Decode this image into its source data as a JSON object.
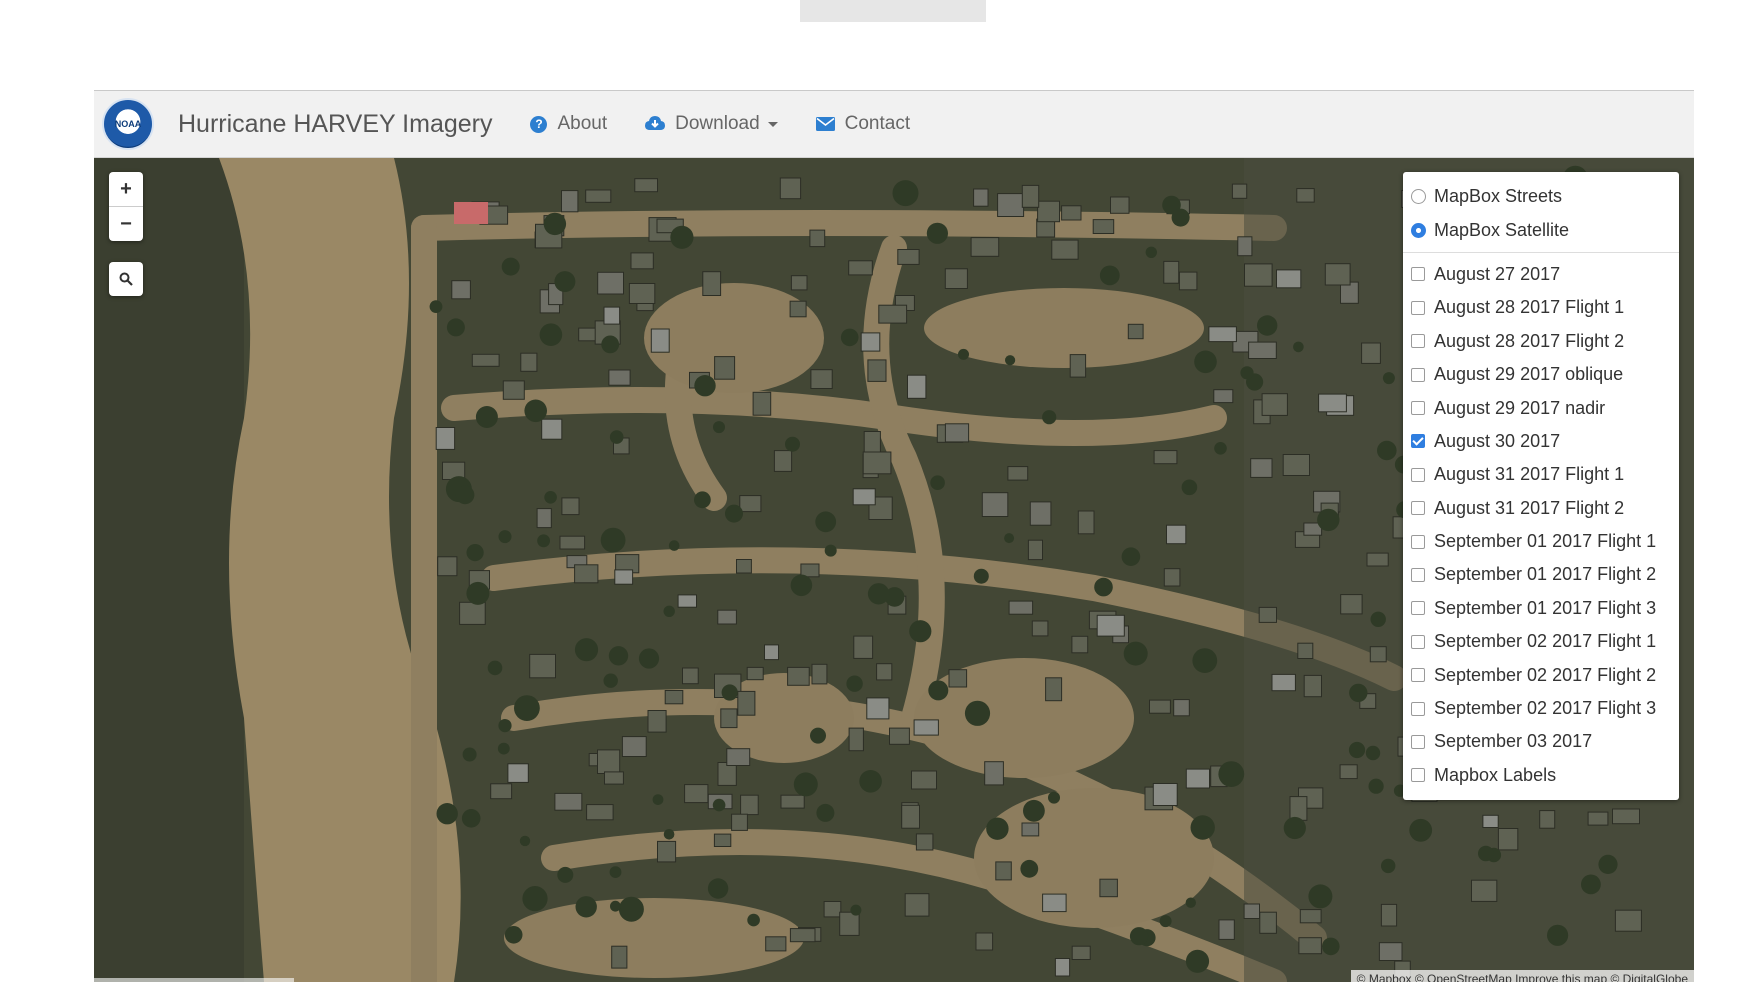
{
  "navbar": {
    "logo_text": "NOAA",
    "brand": "Hurricane HARVEY Imagery",
    "items": [
      {
        "label": "About",
        "icon": "question-circle-icon"
      },
      {
        "label": "Download",
        "icon": "cloud-download-icon",
        "dropdown": true
      },
      {
        "label": "Contact",
        "icon": "envelope-icon"
      }
    ]
  },
  "map": {
    "zoom_in": "+",
    "zoom_out": "−",
    "search_icon": "search-icon",
    "attribution": "© Mapbox © OpenStreetMap Improve this map © DigitalGlobe",
    "colors": {
      "flood_water": "#9c8a67",
      "land_dark": "#454a37",
      "radio_selected": "#2f7ee0"
    }
  },
  "layers": {
    "base": [
      {
        "label": "MapBox Streets",
        "selected": false
      },
      {
        "label": "MapBox Satellite",
        "selected": true
      }
    ],
    "overlays": [
      {
        "label": "August 27 2017",
        "checked": false
      },
      {
        "label": "August 28 2017 Flight 1",
        "checked": false
      },
      {
        "label": "August 28 2017 Flight 2",
        "checked": false
      },
      {
        "label": "August 29 2017 oblique",
        "checked": false
      },
      {
        "label": "August 29 2017 nadir",
        "checked": false
      },
      {
        "label": "August 30 2017",
        "checked": true
      },
      {
        "label": "August 31 2017 Flight 1",
        "checked": false
      },
      {
        "label": "August 31 2017 Flight 2",
        "checked": false
      },
      {
        "label": "September 01 2017 Flight 1",
        "checked": false
      },
      {
        "label": "September 01 2017 Flight 2",
        "checked": false
      },
      {
        "label": "September 01 2017 Flight 3",
        "checked": false
      },
      {
        "label": "September 02 2017 Flight 1",
        "checked": false
      },
      {
        "label": "September 02 2017 Flight 2",
        "checked": false
      },
      {
        "label": "September 02 2017 Flight 3",
        "checked": false
      },
      {
        "label": "September 03 2017",
        "checked": false
      },
      {
        "label": "Mapbox Labels",
        "checked": false
      }
    ]
  }
}
